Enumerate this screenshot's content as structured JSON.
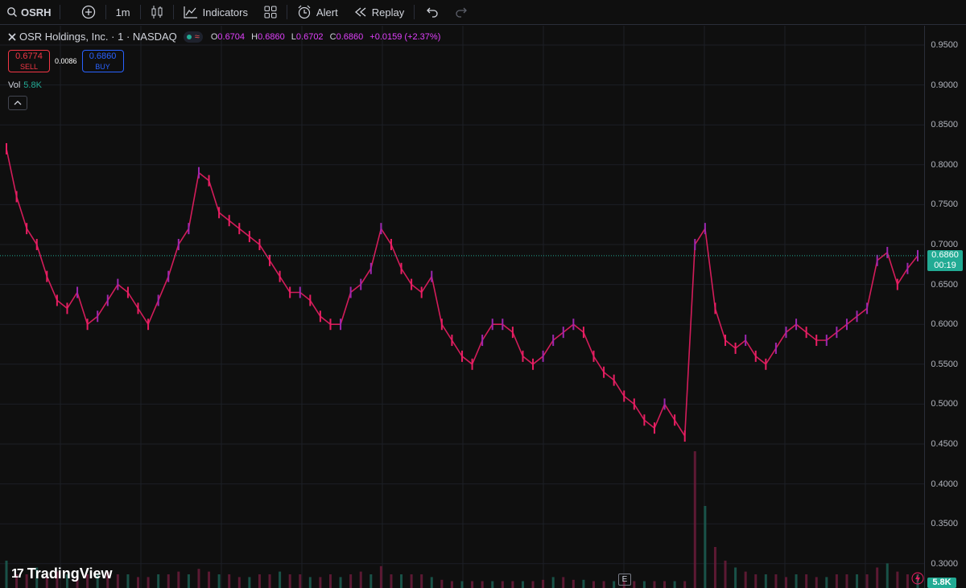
{
  "toolbar": {
    "symbol": "OSRH",
    "interval": "1m",
    "indicators_label": "Indicators",
    "alert_label": "Alert",
    "replay_label": "Replay"
  },
  "legend": {
    "title": "OSR Holdings, Inc. · 1 · NASDAQ",
    "open_key": "O",
    "open": "0.6704",
    "high_key": "H",
    "high": "0.6860",
    "low_key": "L",
    "low": "0.6702",
    "close_key": "C",
    "close": "0.6860",
    "change": "+0.0159 (+2.37%)"
  },
  "trade": {
    "sell_price": "0.6774",
    "sell_label": "SELL",
    "spread": "0.0086",
    "buy_price": "0.6860",
    "buy_label": "BUY"
  },
  "volume": {
    "label": "Vol",
    "value": "5.8K"
  },
  "price_axis": {
    "ticks": [
      "0.9500",
      "0.9000",
      "0.8500",
      "0.8000",
      "0.7500",
      "0.7000",
      "0.6500",
      "0.6000",
      "0.5500",
      "0.5000",
      "0.4500",
      "0.4000",
      "0.3500",
      "0.3000"
    ],
    "current_price": "0.6860",
    "countdown": "00:19",
    "volume_badge": "5.8K"
  },
  "footer": {
    "brand": "TradingView",
    "event_marker": "E"
  },
  "colors": {
    "up": "#22ab94",
    "down": "#e91e63",
    "accent": "#9c27b0",
    "current_line": "#22ab94"
  },
  "chart_data": {
    "type": "line",
    "x_label": "",
    "y_label": "",
    "ylim": [
      0.28,
      0.98
    ],
    "grid": true,
    "current_price": 0.686,
    "series": [
      {
        "values": [
          0.82,
          0.76,
          0.72,
          0.7,
          0.66,
          0.63,
          0.62,
          0.64,
          0.6,
          0.61,
          0.63,
          0.65,
          0.64,
          0.62,
          0.6,
          0.63,
          0.66,
          0.7,
          0.72,
          0.79,
          0.78,
          0.74,
          0.73,
          0.72,
          0.71,
          0.7,
          0.68,
          0.66,
          0.64,
          0.64,
          0.63,
          0.61,
          0.6,
          0.6,
          0.64,
          0.65,
          0.67,
          0.72,
          0.7,
          0.67,
          0.65,
          0.64,
          0.66,
          0.6,
          0.58,
          0.56,
          0.55,
          0.58,
          0.6,
          0.6,
          0.59,
          0.56,
          0.55,
          0.56,
          0.58,
          0.59,
          0.6,
          0.59,
          0.56,
          0.54,
          0.53,
          0.51,
          0.5,
          0.48,
          0.47,
          0.5,
          0.48,
          0.46,
          0.7,
          0.72,
          0.62,
          0.58,
          0.57,
          0.58,
          0.56,
          0.55,
          0.57,
          0.59,
          0.6,
          0.59,
          0.58,
          0.58,
          0.59,
          0.6,
          0.61,
          0.62,
          0.68,
          0.69,
          0.65,
          0.67,
          0.686
        ]
      }
    ],
    "volume": [
      0.2,
      0.1,
      0.1,
      0.15,
      0.1,
      0.12,
      0.1,
      0.08,
      0.1,
      0.1,
      0.12,
      0.1,
      0.1,
      0.08,
      0.08,
      0.1,
      0.1,
      0.12,
      0.1,
      0.14,
      0.12,
      0.1,
      0.1,
      0.08,
      0.08,
      0.1,
      0.1,
      0.12,
      0.1,
      0.1,
      0.08,
      0.08,
      0.1,
      0.08,
      0.1,
      0.12,
      0.1,
      0.16,
      0.1,
      0.1,
      0.1,
      0.1,
      0.08,
      0.06,
      0.05,
      0.05,
      0.05,
      0.05,
      0.05,
      0.05,
      0.05,
      0.05,
      0.05,
      0.06,
      0.08,
      0.08,
      0.06,
      0.06,
      0.05,
      0.05,
      0.05,
      0.05,
      0.05,
      0.05,
      0.05,
      0.05,
      0.05,
      0.05,
      1.0,
      0.6,
      0.3,
      0.2,
      0.15,
      0.12,
      0.1,
      0.1,
      0.1,
      0.08,
      0.1,
      0.1,
      0.08,
      0.08,
      0.1,
      0.1,
      0.1,
      0.1,
      0.15,
      0.18,
      0.12,
      0.1,
      0.1
    ]
  }
}
